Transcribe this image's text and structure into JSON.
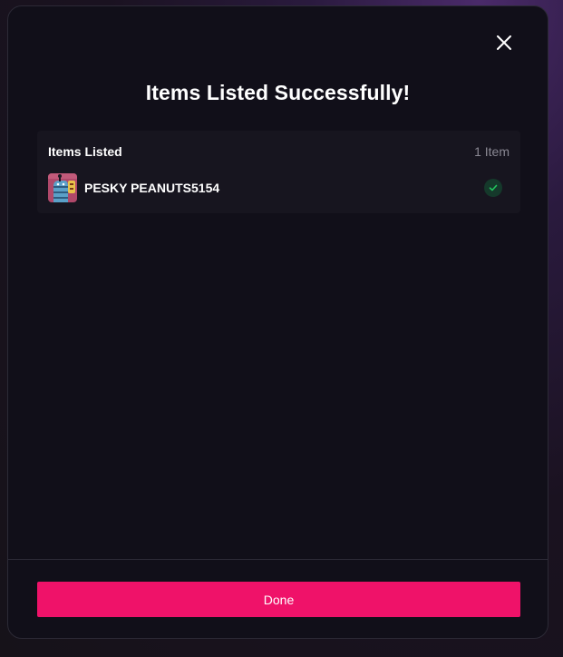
{
  "modal": {
    "title": "Items Listed Successfully!",
    "close_icon": "close-icon"
  },
  "panel": {
    "title": "Items Listed",
    "count": "1 Item",
    "items": [
      {
        "name": "PESKY PEANUTS5154",
        "status_icon": "check-icon",
        "status_color": "#22c55e"
      }
    ]
  },
  "footer": {
    "done_label": "Done",
    "accent_color": "#ef1269"
  }
}
